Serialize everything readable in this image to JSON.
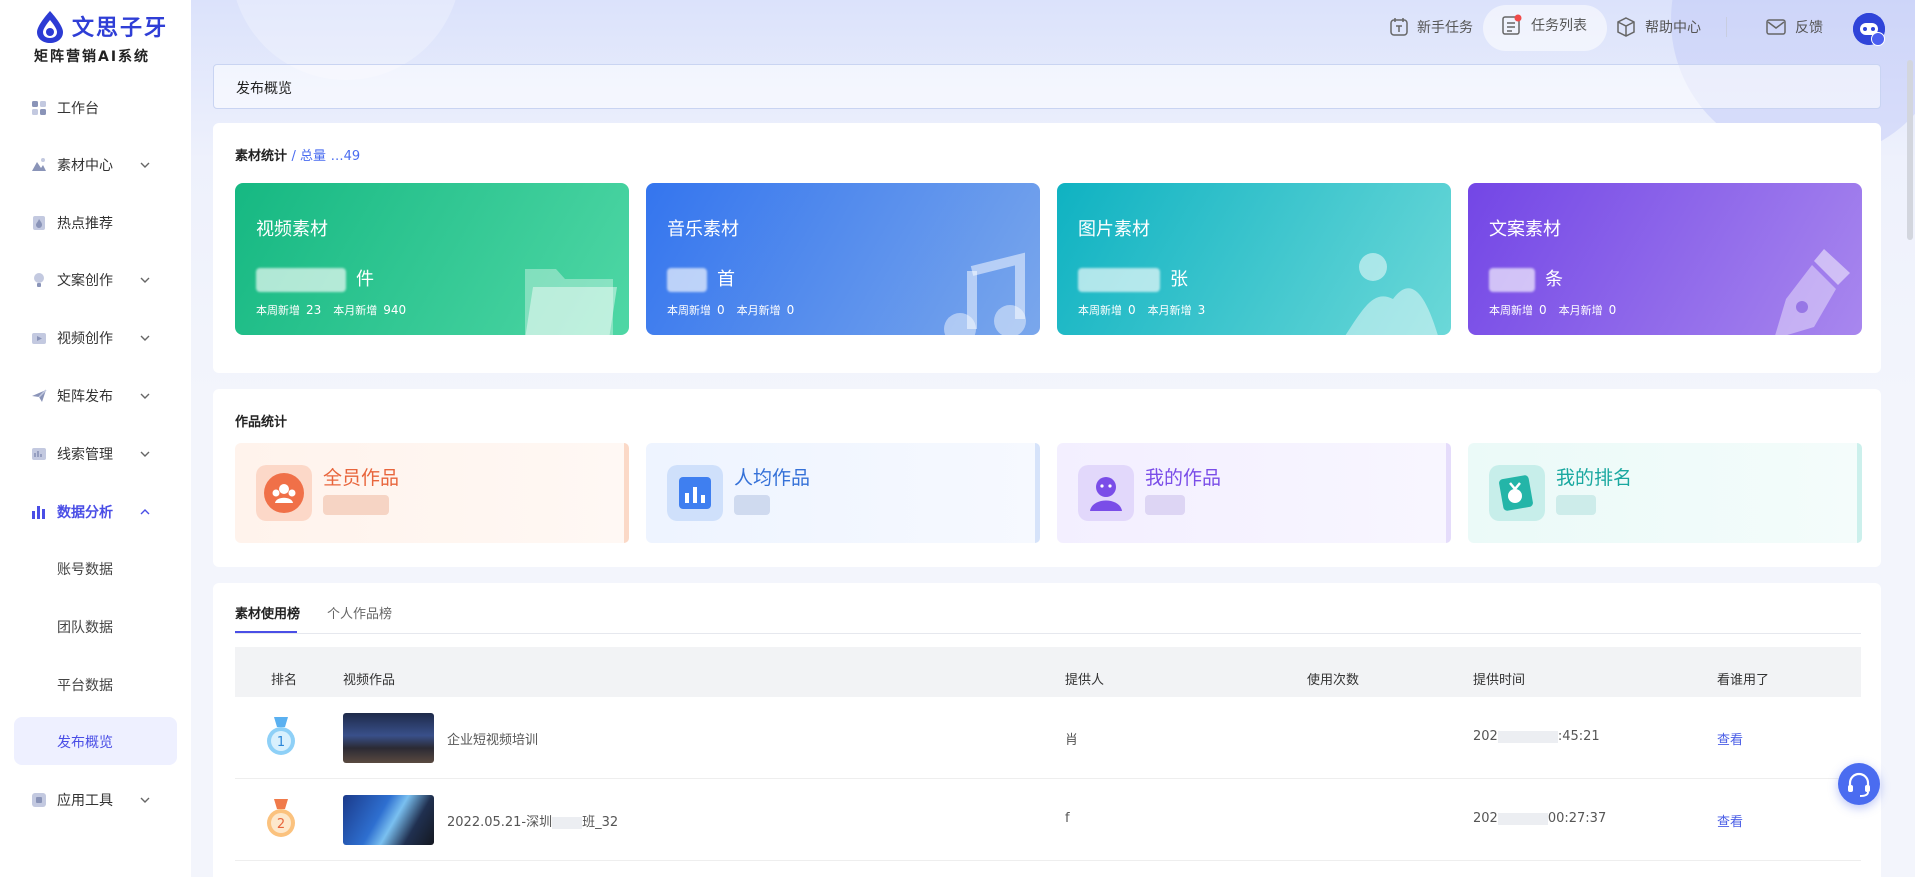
{
  "brand": {
    "name": "文思子牙",
    "subtitle": "矩阵营销AI系统"
  },
  "sidebar": {
    "items": [
      {
        "label": "工作台",
        "icon": "dashboard-icon"
      },
      {
        "label": "素材中心",
        "icon": "material-icon"
      },
      {
        "label": "热点推荐",
        "icon": "hot-icon"
      },
      {
        "label": "文案创作",
        "icon": "bulb-icon"
      },
      {
        "label": "视频创作",
        "icon": "video-icon"
      },
      {
        "label": "矩阵发布",
        "icon": "send-icon"
      },
      {
        "label": "线索管理",
        "icon": "leads-icon"
      },
      {
        "label": "数据分析",
        "icon": "chart-icon"
      },
      {
        "label": "应用工具",
        "icon": "tools-icon"
      }
    ],
    "sub_items": [
      {
        "label": "账号数据"
      },
      {
        "label": "团队数据"
      },
      {
        "label": "平台数据"
      },
      {
        "label": "发布概览"
      }
    ]
  },
  "topbar": {
    "newbie_task": "新手任务",
    "task_list": "任务列表",
    "help_center": "帮助中心",
    "feedback": "反馈"
  },
  "breadcrumb": "发布概览",
  "material_stats": {
    "title": "素材统计",
    "total_label": "/ 总量",
    "total_value": "…49",
    "cards": [
      {
        "title": "视频素材",
        "unit": "件",
        "week_label": "本周新增",
        "week": "23",
        "month_label": "本月新增",
        "month": "940",
        "color": "#1fbe86"
      },
      {
        "title": "音乐素材",
        "unit": "首",
        "week_label": "本周新增",
        "week": "0",
        "month_label": "本月新增",
        "month": "0",
        "color": "#3b7ef0"
      },
      {
        "title": "图片素材",
        "unit": "张",
        "week_label": "本周新增",
        "week": "0",
        "month_label": "本月新增",
        "month": "3",
        "color": "#15b7c6"
      },
      {
        "title": "文案素材",
        "unit": "条",
        "week_label": "本周新增",
        "week": "0",
        "month_label": "本月新增",
        "month": "0",
        "color": "#7a4de8"
      }
    ]
  },
  "work_stats": {
    "title": "作品统计",
    "cards": [
      {
        "title": "全员作品",
        "color": "#e8653c"
      },
      {
        "title": "人均作品",
        "color": "#3571d8"
      },
      {
        "title": "我的作品",
        "color": "#7a4de8"
      },
      {
        "title": "我的排名",
        "color": "#1aa8a0"
      }
    ]
  },
  "ranking": {
    "tabs": [
      "素材使用榜",
      "个人作品榜"
    ],
    "columns": [
      "排名",
      "视频作品",
      "提供人",
      "使用次数",
      "提供时间",
      "看谁用了"
    ],
    "rows": [
      {
        "rank": "1",
        "name": "企业短视频培训",
        "provider": "肖",
        "time_start": "202",
        "time_end": ":45:21",
        "action": "查看"
      },
      {
        "rank": "2",
        "name": "2022.05.21-深圳",
        "name_tail": "班_32",
        "provider": "f",
        "time_start": "202",
        "time_end": "00:27:37",
        "action": "查看"
      }
    ]
  }
}
